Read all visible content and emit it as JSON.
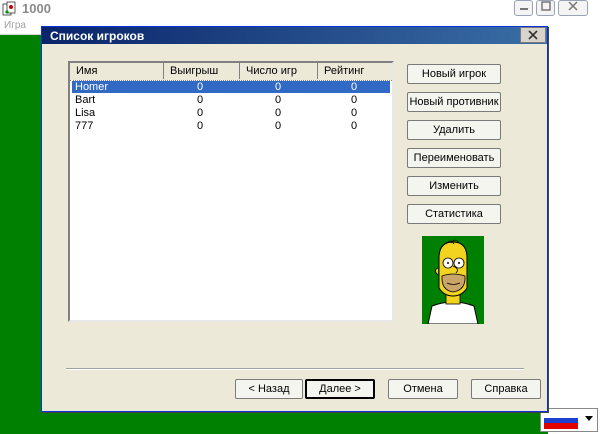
{
  "app": {
    "title": "1000",
    "menu": [
      "Игра"
    ],
    "controls": [
      "minimize",
      "maximize",
      "close"
    ]
  },
  "dialog": {
    "title": "Список игроков",
    "table": {
      "columns": [
        "Имя",
        "Выигрыш",
        "Число игр",
        "Рейтинг"
      ],
      "rows": [
        {
          "name": "Homer",
          "wins": "0",
          "games": "0",
          "rating": "0",
          "selected": true
        },
        {
          "name": "Bart",
          "wins": "0",
          "games": "0",
          "rating": "0"
        },
        {
          "name": "Lisa",
          "wins": "0",
          "games": "0",
          "rating": "0"
        },
        {
          "name": "777",
          "wins": "0",
          "games": "0",
          "rating": "0"
        }
      ]
    },
    "side_buttons": {
      "new_player": "Новый игрок",
      "new_opponent": "Новый противник",
      "delete": "Удалить",
      "rename": "Переименовать",
      "edit": "Изменить",
      "statistics": "Статистика"
    },
    "bottom_buttons": {
      "back": "< Назад",
      "next": "Далее >",
      "cancel": "Отмена",
      "help": "Справка"
    }
  },
  "language": "ru",
  "colors": {
    "background": "#008000",
    "title_bar": "#0a246a",
    "selection": "#316ac5"
  }
}
